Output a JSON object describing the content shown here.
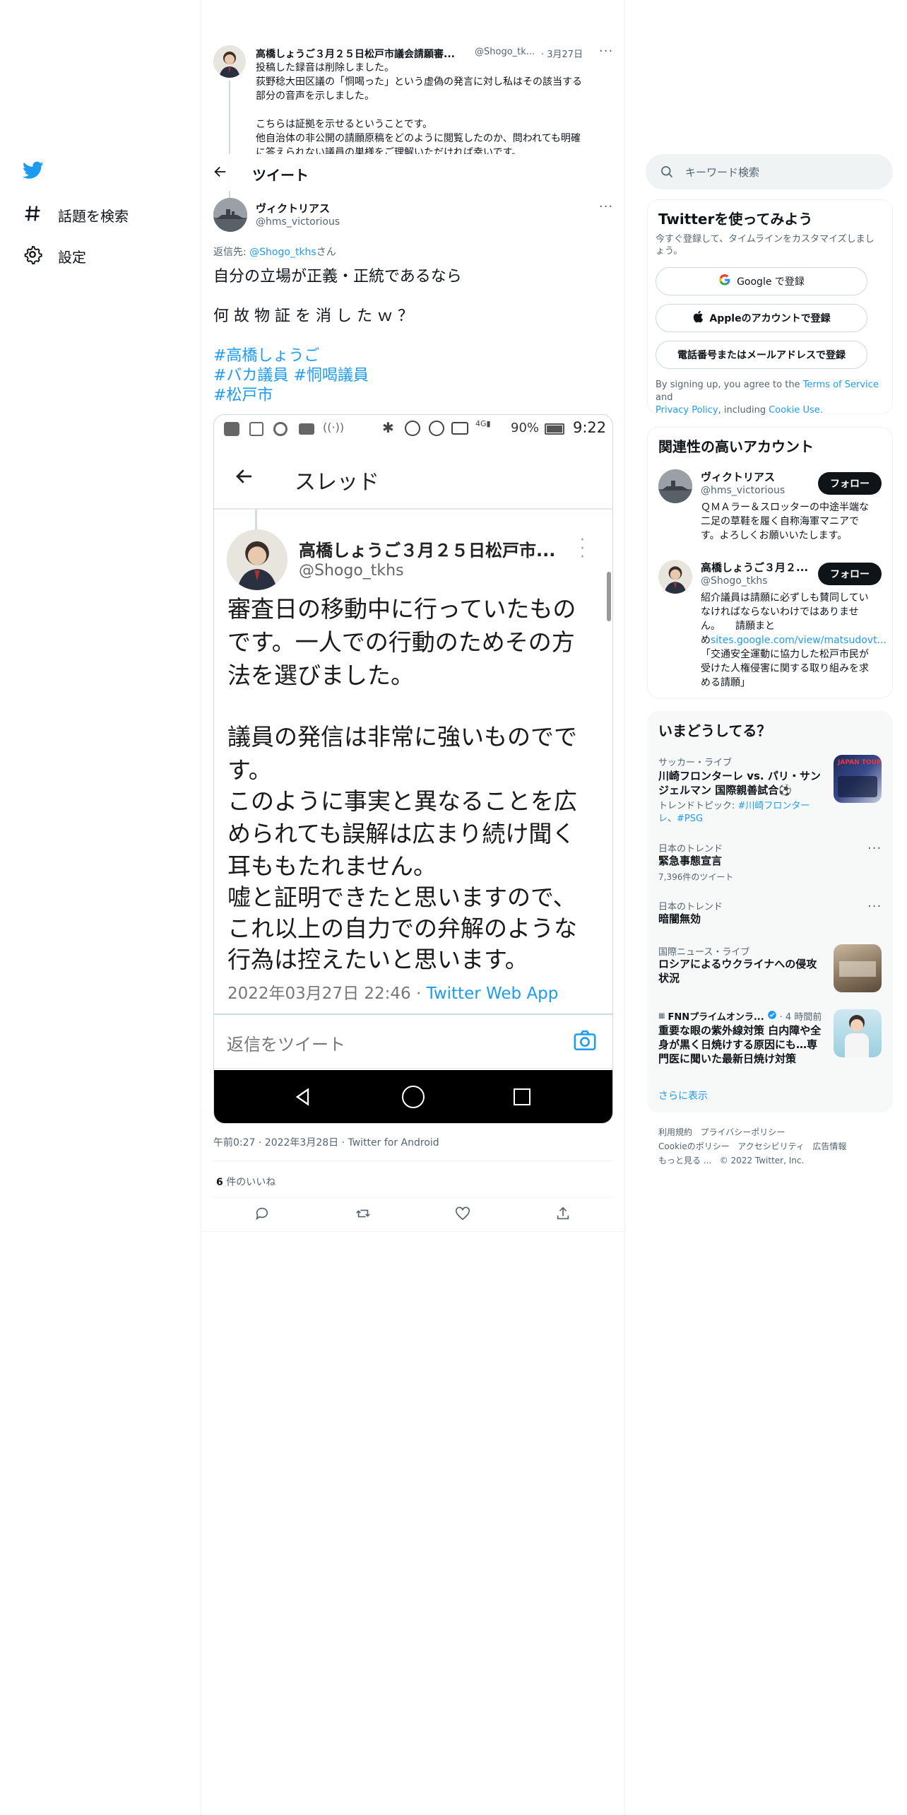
{
  "nav": {
    "explore_label": "話題を検索",
    "settings_label": "設定"
  },
  "header": {
    "title": "ツイート"
  },
  "parent_tweet": {
    "name": "高橋しょうご３月２５日松戸市議会請願審...",
    "handle": "@Shogo_tk...",
    "date": "· 3月27日",
    "line1": "投稿した録音は削除しました。",
    "line2": "荻野稔大田区議の「恫喝った」という虚偽の発言に対し私はその該当する",
    "line3": "部分の音声を示しました。",
    "line4": "こちらは証拠を示せるということです。",
    "line5": "他自治体の非公開の請願原稿をどのように閲覧したのか、問われても明確",
    "line6": "に答えられない議員の巣様をご理解いただければ幸いです。"
  },
  "main_tweet": {
    "name": "ヴィクトリアス",
    "handle": "@hms_victorious",
    "reply_prefix": "返信先: ",
    "reply_to": "@Shogo_tkhs",
    "reply_suffix": "さん",
    "line1": "自分の立場が正義・正統であるなら",
    "line2": "何 故 物 証 を 消 し た ｗ ？",
    "hashtag1": "#高橋しょうご",
    "hashtag2": "#バカ議員",
    "hashtag3": "#恫喝議員",
    "hashtag4": "#松戸市",
    "meta": "午前0:27 · 2022年3月28日 · Twitter for Android",
    "likes_count": "6",
    "likes_label": " 件のいいね"
  },
  "screenshot": {
    "battery": "90%",
    "time": "9:22",
    "title": "スレッド",
    "name": "高橋しょうご３月２５日松戸市...",
    "handle": "@Shogo_tkhs",
    "line1": "審査日の移動中に行っていたもの",
    "line2": "です。一人での行動のためその方",
    "line3": "法を選びました。",
    "line4": "議員の発信は非常に強いものでで",
    "line5": "す。",
    "line6": "このように事実と異なることを広",
    "line7": "められても誤解は広まり続け聞く",
    "line8": "耳ももたれません。",
    "line9": "嘘と証明できたと思いますので、",
    "line10": "これ以上の自力での弁解のような",
    "line11": "行為は控えたいと思います。",
    "timestamp": "2022年03月27日 22:46 · ",
    "source": "Twitter Web App",
    "reply_placeholder": "返信をツイート"
  },
  "search": {
    "placeholder": "キーワード検索"
  },
  "signup": {
    "title": "Twitterを使ってみよう",
    "desc": "今すぐ登録して、タイムラインをカスタマイズしましょう。",
    "google_label": "Google で登録",
    "apple_label": "Appleのアカウントで登録",
    "phone_label": "電話番号またはメールアドレスで登録",
    "terms_prefix": "By signing up, you agree to the ",
    "terms_link": "Terms of Service",
    "terms_and": " and",
    "privacy_link": "Privacy Policy",
    "terms_including": ", including ",
    "cookie_link": "Cookie Use."
  },
  "related": {
    "title": "関連性の高いアカウント",
    "follow_label": "フォロー",
    "accounts": [
      {
        "name": "ヴィクトリアス",
        "handle": "@hms_victorious",
        "bio1": "ＱＭＡラー＆スロッターの中途半端な",
        "bio2": "二足の草鞋を履く自称海軍マニアで",
        "bio3": "す。よろしくお願いいたします。"
      },
      {
        "name": "高橋しょうご３月２...",
        "handle": "@Shogo_tkhs",
        "bio1": "紹介議員は請願に必ずしも賛同してい",
        "bio2": "なければならないわけではありませ",
        "bio3": "ん。　　請願まと",
        "bio4_prefix": "め",
        "bio4_link": "sites.google.com/view/matsudovt...",
        "bio5": "「交通安全運動に協力した松戸市民が",
        "bio6": "受けた人権侵害に関する取り組みを求",
        "bio7": "める請願」"
      }
    ]
  },
  "trends": {
    "title": "いまどうしてる？",
    "items": [
      {
        "category": "サッカー・ライブ",
        "title1": "川崎フロンターレ vs. パリ・サン",
        "title2": "ジェルマン 国際親善試合⚽",
        "topic_prefix": "トレンドトピック: ",
        "topic_link1": "#川崎フロンター",
        "topic_link2": "レ",
        "topic_sep": "、",
        "topic_link3": "#PSG"
      },
      {
        "category": "日本のトレンド",
        "title": "緊急事態宣言",
        "count": "7,396件のツイート"
      },
      {
        "category": "日本のトレンド",
        "title": "暗闇無効"
      },
      {
        "category": "国際ニュース・ライブ",
        "title1": "ロシアによるウクライナへの侵攻",
        "title2": "状況"
      },
      {
        "source": "FNNプライムオンラ...",
        "time": "· 4 時間前",
        "title1": "重要な眼の紫外線対策 白内障や全",
        "title2": "身が黒く日焼けする原因にも…専",
        "title3": "門医に聞いた最新日焼け対策"
      }
    ],
    "show_more": "さらに表示"
  },
  "footer": {
    "terms": "利用規約",
    "privacy": "プライバシーポリシー",
    "cookie": "Cookieのポリシー",
    "accessibility": "アクセシビリティ",
    "ads": "広告情報",
    "more": "もっと見る ...",
    "copyright": "© 2022 Twitter, Inc."
  },
  "colors": {
    "accent": "#1d9bf0",
    "text": "#0f1419",
    "muted": "#536471",
    "border": "#eff3f4"
  }
}
